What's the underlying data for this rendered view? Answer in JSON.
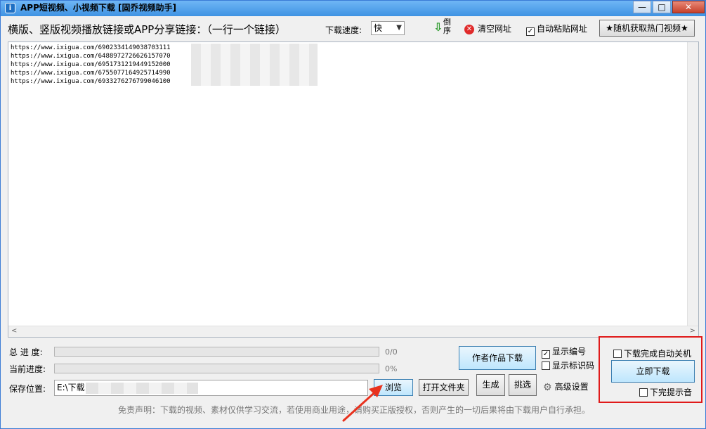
{
  "window": {
    "title": "APP短视频、小视频下载 [固乔视频助手]",
    "icon_glyph": "i",
    "min_glyph": "—",
    "max_glyph": "□",
    "close_glyph": "✕"
  },
  "toolbar": {
    "prompt": "横版、竖版视频播放链接或APP分享链接：（一行一个链接）",
    "speed_label": "下载速度:",
    "speed_value": "快",
    "reverse_label": "倒序",
    "clear_label": "清空网址",
    "autopaste_label": "自动粘贴网址",
    "autopaste_checked": true,
    "random_label": "★随机获取热门视频★"
  },
  "urls": [
    "https://www.ixigua.com/6902334149038703111",
    "https://www.ixigua.com/6488972726626157070",
    "https://www.ixigua.com/6951731219449152000",
    "https://www.ixigua.com/6755077164925714990",
    "https://www.ixigua.com/6933276276799046100"
  ],
  "progress": {
    "total_label": "总 进 度:",
    "total_value": "0/0",
    "total_fraction": 0,
    "current_label": "当前进度:",
    "current_value": "0%",
    "current_fraction": 0
  },
  "save": {
    "label": "保存位置:",
    "path": "E:\\下载"
  },
  "buttons": {
    "browse": "浏览",
    "open_folder": "打开文件夹",
    "generate": "生成",
    "pick": "挑选",
    "author": "作者作品下载",
    "download_now": "立即下载"
  },
  "options": {
    "show_number": "显示编号",
    "show_number_checked": true,
    "show_mark": "显示标识码",
    "show_mark_checked": false,
    "advanced": "高级设置",
    "shutdown": "下载完成自动关机",
    "shutdown_checked": false,
    "done_sound": "下完提示音",
    "done_sound_checked": false
  },
  "disclaimer": "免责声明：下载的视频、素材仅供学习交流，若使用商业用途，请购买正版授权，否则产生的一切后果将由下载用户自行承担。",
  "colors": {
    "highlight_box": "#e01a1a",
    "annotation_arrow": "#e8321e"
  }
}
